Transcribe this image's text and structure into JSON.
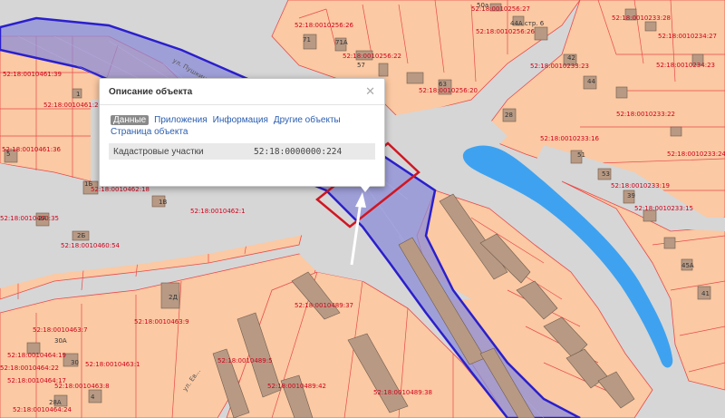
{
  "popup": {
    "title": "Описание объекта",
    "close_icon": "close-icon",
    "tabs": [
      "Данные",
      "Приложения",
      "Информация",
      "Другие объекты"
    ],
    "object_page_link": "Страница объекта",
    "attribute_label": "Кадастровые участки",
    "attribute_value": "52:18:0000000:224"
  },
  "colors": {
    "parcel": "#fbc9a3",
    "parcel_border": "#e84a4a",
    "building": "#b89a84",
    "road": "#d6d6d6",
    "water": "#3ea2f0",
    "selected_fill": "#8c8cd8",
    "selected_border": "#2a1fcc",
    "highlight": "#d01722"
  },
  "map": {
    "streets": [
      "ул. Пушкинская",
      "ул. Ев..."
    ],
    "cadastral_labels": [
      "52:18:0010256:26",
      "52:18:0010256:27",
      "52:18:0010256:26",
      "52:18:0010256:22",
      "52:18:0010256:20",
      "52:18:0010233:28",
      "52:18:0010234:27",
      "52:18:0010234:23",
      "52:18:0010233:23",
      "52:18:0010233:22",
      "52:18:0010233:16",
      "52:18:0010233:24",
      "52:18:0010233:19",
      "52:18:0010233:15",
      "52:18:0010461:39",
      "52:18:0010461:26",
      "52:18:0010461:36",
      "52:18:0010462:18",
      "52:18:0010462:1",
      "52:18:0010460:35",
      "52:18:0010460:54",
      "52:18:0010489:37",
      "52:18:0010463:9",
      "52:18:0010463:7",
      "52:18:0010463:1",
      "52:18:0010489:5",
      "52:18:0010489:42",
      "52:18:0010489:38",
      "52:18:0010464:19",
      "52:18:0010464:22",
      "52:18:0010464:17",
      "52:18:0010463:8",
      "52:18:0010464:24"
    ],
    "house_numbers": [
      "50а",
      "44А стр. 6",
      "71",
      "71А",
      "57",
      "63",
      "42",
      "44",
      "28",
      "51",
      "53",
      "39",
      "45А",
      "41",
      "5",
      "1",
      "1Б",
      "1В",
      "2А",
      "2Б",
      "2Д",
      "30А",
      "30",
      "28А",
      "4"
    ]
  }
}
